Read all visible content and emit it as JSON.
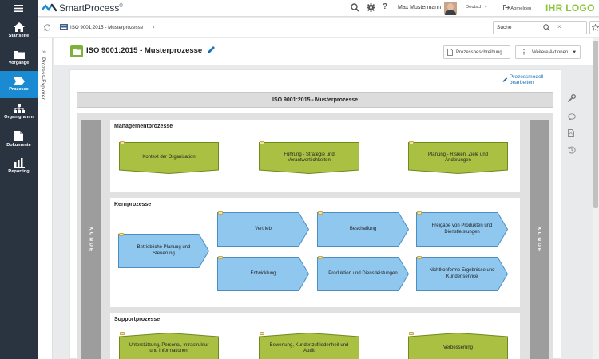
{
  "nav": {
    "items": [
      {
        "label": "Startseite",
        "icon": "home-icon",
        "active": false
      },
      {
        "label": "Vorgänge",
        "icon": "folder-icon",
        "active": false
      },
      {
        "label": "Prozesse",
        "icon": "process-icon",
        "active": true
      },
      {
        "label": "Organigramm",
        "icon": "org-chart-icon",
        "active": false
      },
      {
        "label": "Dokumente",
        "icon": "document-icon",
        "active": false
      },
      {
        "label": "Reporting",
        "icon": "bar-chart-icon",
        "active": false
      }
    ]
  },
  "topbar": {
    "app_name": "SmartProcess",
    "app_mark": "®",
    "user_name": "Max Mustermann",
    "language": "Deutsch",
    "logout": "Abmelden",
    "brand_logo": "IHR LOGO"
  },
  "breadcrumb": {
    "item": "ISO 9001:2015 - Musterprozesse"
  },
  "search": {
    "value": "Suche"
  },
  "explorer": {
    "label": "Prozess-Explorer"
  },
  "titlebar": {
    "title": "ISO 9001:2015 - Musterprozesse",
    "desc_button": "Prozessbeschreibung",
    "more_button": "Weitere Aktionen"
  },
  "canvas": {
    "edit_link": "Prozessmodell bearbeiten",
    "header": "ISO 9001:2015 - Musterprozesse",
    "customer_label": "KUNDE",
    "sections": {
      "management": {
        "title": "Managementprozesse",
        "items": [
          "Kontext der Organisation",
          "Führung - Strategie und Verantwortlichkeiten",
          "Planung - Risiken, Ziele und Änderungen"
        ]
      },
      "core": {
        "title": "Kernprozesse",
        "items": [
          "Betriebliche Planung und Steuerung",
          "Vertrieb",
          "Beschaffung",
          "Freigabe von Produkten und Dienstleistungen",
          "Entwicklung",
          "Produktion und Dienstleistungen",
          "Nichtkonforme Ergebnisse und Kundenservice"
        ]
      },
      "support": {
        "title": "Supportprozesse",
        "items": [
          "Unterstützung, Personal, Infrastruktur und Informationen",
          "Bewertung, Kundenzufriedenheit und Audit",
          "Verbesserung"
        ]
      }
    }
  },
  "colors": {
    "nav_bg": "#2a3441",
    "nav_active": "#1a8bd2",
    "management_fill": "#a9c043",
    "core_fill": "#8fc7ef",
    "brand": "#8dc63f"
  }
}
